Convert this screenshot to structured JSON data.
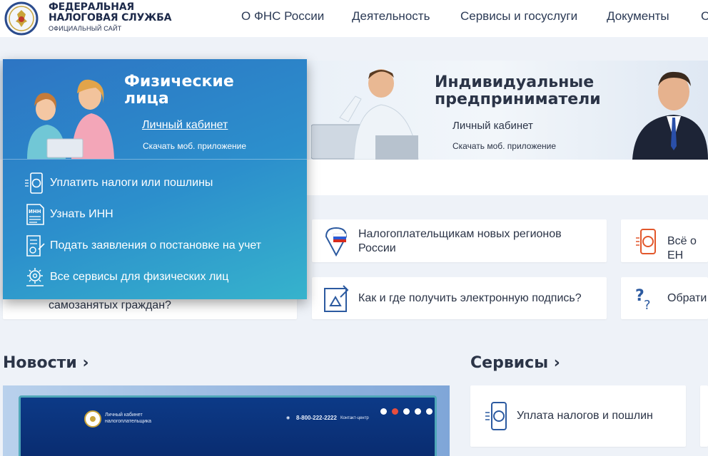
{
  "header": {
    "logo": {
      "line1": "ФЕДЕРАЛЬНАЯ",
      "line2": "НАЛОГОВАЯ СЛУЖБА",
      "line3": "ОФИЦИАЛЬНЫЙ САЙТ"
    },
    "nav": [
      "О ФНС России",
      "Деятельность",
      "Сервисы и госуслуги",
      "Документы",
      "С"
    ]
  },
  "hero": {
    "individuals": {
      "title_line1": "Физические",
      "title_line2": "лица",
      "cabinet": "Личный кабинет",
      "app": "Скачать моб. приложение"
    },
    "entrepreneurs": {
      "title_line1": "Индивидуальные",
      "title_line2": "предприниматели",
      "cabinet": "Личный кабинет",
      "app": "Скачать моб. приложение"
    }
  },
  "dropdown": {
    "items": [
      {
        "label": "Уплатить налоги или пошлины",
        "icon": "phone-ruble-icon"
      },
      {
        "label": "Узнать ИНН",
        "icon": "inn-document-icon"
      },
      {
        "label": "Подать заявления о постановке на учет",
        "icon": "application-form-icon"
      },
      {
        "label": "Все сервисы для физических лиц",
        "icon": "gear-services-icon"
      }
    ]
  },
  "cards": {
    "selfemployed_partial": "самозанятых граждан?",
    "new_regions": "Налогоплательщикам новых регионов России",
    "all_about_partial": "Всё о ЕН",
    "e_signature": "Как и где получить электронную подпись?",
    "contact_partial": "Обрати"
  },
  "sections": {
    "news": "Новости",
    "services": "Сервисы"
  },
  "news_banner": {
    "cabinet_line1": "Личный кабинет",
    "cabinet_line2": "налогоплательщика",
    "phone": "8-800-222-2222",
    "contact": "Контакт-центр"
  },
  "services": {
    "tax_payment": "Уплата налогов и пошлин"
  },
  "colors": {
    "accent": "#2c8fcc",
    "text": "#2b3447",
    "slider_active": "#e94e3d"
  }
}
